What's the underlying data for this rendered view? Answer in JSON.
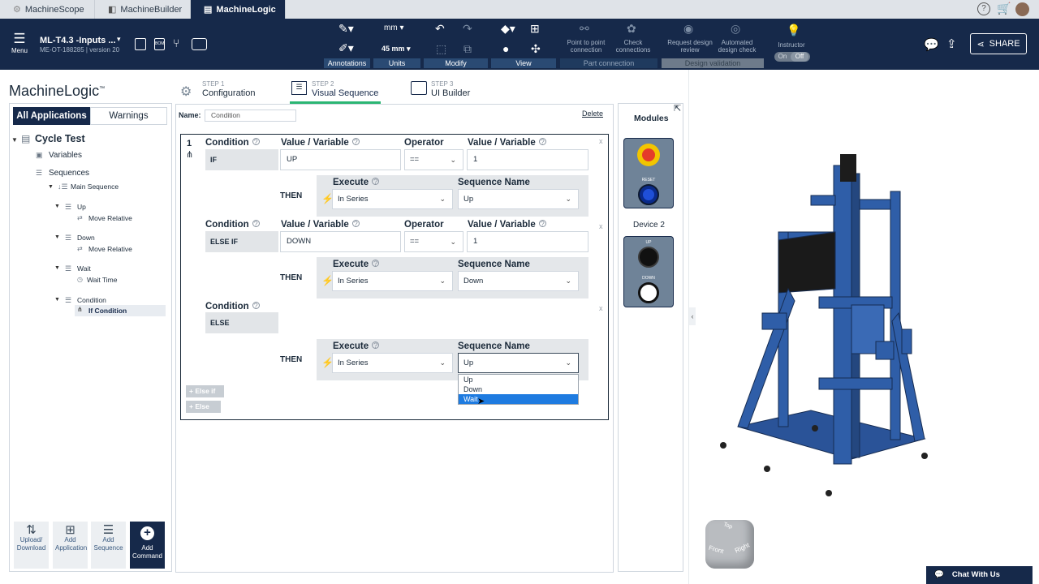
{
  "browser_tabs": [
    {
      "label": "MachineScope",
      "icon": "scope-icon"
    },
    {
      "label": "MachineBuilder",
      "icon": "cube-icon"
    },
    {
      "label": "MachineLogic",
      "icon": "logic-icon"
    }
  ],
  "header": {
    "menu_label": "Menu",
    "project_title": "ML-T4.3 -Inputs ...",
    "project_sub": "ME-OT-188285 | version 20",
    "units_value": "45 mm",
    "units_top": "mm",
    "groups": {
      "annotations": "Annotations",
      "units": "Units",
      "modify": "Modify",
      "view": "View",
      "part_connection": "Part connection",
      "design_validation": "Design validation"
    },
    "part_connection_items": [
      "Point to point connection",
      "Check connections"
    ],
    "design_validation_items": [
      "Request design review",
      "Automated design check"
    ],
    "instructor_label": "Instructor",
    "toggle_on": "On",
    "toggle_off": "Off",
    "share_label": "SHARE"
  },
  "app_title": "MachineLogic",
  "app_title_tm": "™",
  "left_panel": {
    "tabs": [
      "All Applications",
      "Warnings"
    ],
    "tree": {
      "root": "Cycle Test",
      "variables": "Variables",
      "sequences": "Sequences",
      "main_sequence": "Main Sequence",
      "up": "Up",
      "up_child": "Move Relative",
      "down": "Down",
      "down_child": "Move Relative",
      "wait": "Wait",
      "wait_child": "Wait Time",
      "condition": "Condition",
      "condition_child": "If Condition"
    },
    "bottom_buttons": [
      "Upload/ Download",
      "Add Application",
      "Add Sequence",
      "Add Command"
    ]
  },
  "steps": [
    {
      "step": "STEP 1",
      "label": "Configuration"
    },
    {
      "step": "STEP 2",
      "label": "Visual Sequence"
    },
    {
      "step": "STEP 3",
      "label": "UI Builder"
    }
  ],
  "editor": {
    "name_label": "Name:",
    "name_value": "Condition",
    "delete_label": "Delete",
    "block_number": "1",
    "headers": {
      "condition": "Condition",
      "value_variable": "Value / Variable",
      "operator": "Operator",
      "execute": "Execute",
      "sequence_name": "Sequence Name"
    },
    "then_label": "THEN",
    "rows": [
      {
        "type": "IF",
        "lhs": "UP",
        "op": "==",
        "rhs": "1",
        "execute": "In Series",
        "sequence": "Up"
      },
      {
        "type": "ELSE IF",
        "lhs": "DOWN",
        "op": "==",
        "rhs": "1",
        "execute": "In Series",
        "sequence": "Down"
      },
      {
        "type": "ELSE",
        "execute": "In Series",
        "sequence": "Up"
      }
    ],
    "dropdown_options": [
      "Up",
      "Down",
      "Wait"
    ],
    "dropdown_selected": "Wait",
    "else_if_button": "Else if",
    "else_button": "Else"
  },
  "modules": {
    "title": "Modules",
    "device1_reset_label": "RESET",
    "device2_title": "Device 2",
    "device2_up": "UP",
    "device2_down": "DOWN"
  },
  "view_cube": {
    "top": "Top",
    "front": "Front",
    "right": "Right"
  },
  "chat_label": "Chat With Us",
  "colors": {
    "navy": "#16294a",
    "accent_green": "#2bb673",
    "selection_blue": "#1e7be0",
    "frame_blue": "#2f5ea8"
  }
}
